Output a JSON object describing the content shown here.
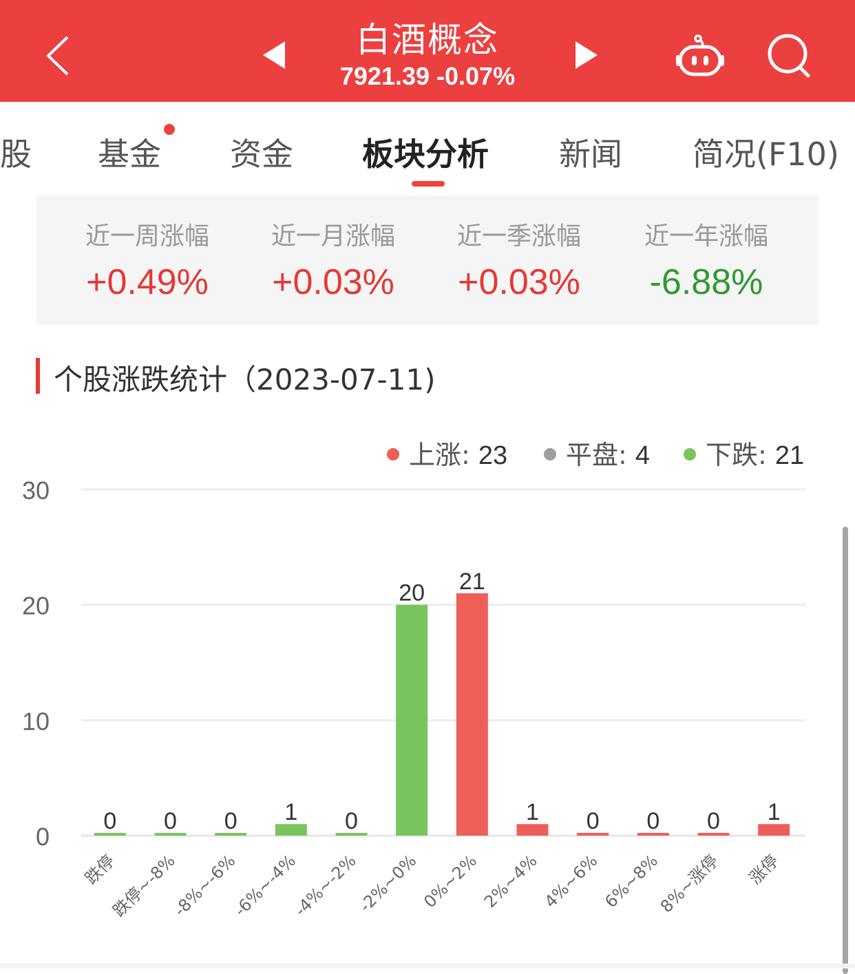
{
  "header": {
    "title": "白酒概念",
    "index_value": "7921.39",
    "change": "-0.07%",
    "subtitle": "7921.39 -0.07%",
    "back_icon": "chevron-left-icon",
    "prev_icon": "triangle-left-icon",
    "next_icon": "triangle-right-icon",
    "robot_icon": "robot-assistant-icon",
    "search_icon": "search-icon"
  },
  "tabs": [
    {
      "label": "股",
      "active": false
    },
    {
      "label": "基金",
      "active": false,
      "badge_dot": true
    },
    {
      "label": "资金",
      "active": false
    },
    {
      "label": "板块分析",
      "active": true
    },
    {
      "label": "新闻",
      "active": false
    },
    {
      "label": "简况(F10)",
      "active": false
    }
  ],
  "performance": [
    {
      "label": "近一周涨幅",
      "value": "+0.49%",
      "direction": "up"
    },
    {
      "label": "近一月涨幅",
      "value": "+0.03%",
      "direction": "up"
    },
    {
      "label": "近一季涨幅",
      "value": "+0.03%",
      "direction": "up"
    },
    {
      "label": "近一年涨幅",
      "value": "-6.88%",
      "direction": "down"
    }
  ],
  "section": {
    "title": "个股涨跌统计（2023-07-11)"
  },
  "legend": [
    {
      "label": "上涨: ",
      "count": "23",
      "color": "#ef5f58"
    },
    {
      "label": "平盘: ",
      "count": "4",
      "color": "#9e9e9e"
    },
    {
      "label": "下跌: ",
      "count": "21",
      "color": "#79c45c"
    }
  ],
  "colors": {
    "header_bg": "#ec3f3f",
    "up": "#e53935",
    "down": "#2e9a2e",
    "bar_up": "#ef5f58",
    "bar_down": "#79c45c",
    "accent": "#f0413c"
  },
  "chart_data": {
    "type": "bar",
    "title": "个股涨跌统计（2023-07-11)",
    "xlabel": "",
    "ylabel": "",
    "ylim": [
      0,
      30
    ],
    "yticks": [
      0,
      10,
      20,
      30
    ],
    "grid": true,
    "legend_position": "top-right",
    "categories": [
      "跌停",
      "跌停~-8%",
      "-8%~-6%",
      "-6%~-4%",
      "-4%~-2%",
      "-2%~0%",
      "0%~2%",
      "2%~4%",
      "4%~6%",
      "6%~8%",
      "8%~涨停",
      "涨停"
    ],
    "values": [
      0,
      0,
      0,
      1,
      0,
      20,
      21,
      1,
      0,
      0,
      0,
      1
    ],
    "bar_colors": [
      "down",
      "down",
      "down",
      "down",
      "down",
      "down",
      "up",
      "up",
      "up",
      "up",
      "up",
      "up"
    ]
  }
}
